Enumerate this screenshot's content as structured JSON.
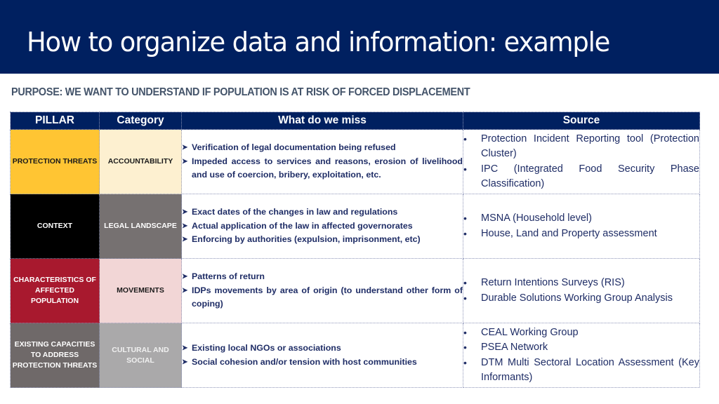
{
  "title": "How to organize data and information: example",
  "purpose": "PURPOSE: WE WANT TO UNDERSTAND IF POPULATION IS AT RISK OF FORCED DISPLACEMENT",
  "table": {
    "headers": [
      "PILLAR",
      "Category",
      "What do we miss",
      "Source"
    ],
    "rows": [
      {
        "pillar": "PROTECTION THREATS",
        "pillar_color": "#ffc533",
        "pillar_text_color": "#1a1a1a",
        "category": "ACCOUNTABILITY",
        "category_color": "#fdf0d0",
        "category_text_color": "#1a1a1a",
        "miss": [
          "Verification of legal documentation being refused",
          "Impeded access to services and reasons, erosion of livelihood and use of coercion, bribery, exploitation, etc."
        ],
        "source": [
          "Protection Incident Reporting tool (Protection Cluster)",
          "IPC (Integrated Food Security Phase Classification)"
        ]
      },
      {
        "pillar": "CONTEXT",
        "pillar_color": "#000000",
        "pillar_text_color": "#ffffff",
        "category": "LEGAL LANDSCAPE",
        "category_color": "#767171",
        "category_text_color": "#ffffff",
        "miss": [
          "Exact dates of the changes in law and regulations",
          "Actual application of the law in affected governorates",
          "Enforcing by authorities (expulsion, imprisonment, etc)"
        ],
        "source": [
          "MSNA (Household level)",
          "House, Land and Property assessment"
        ]
      },
      {
        "pillar": "CHARACTERISTICS OF AFFECTED POPULATION",
        "pillar_color": "#a8192e",
        "pillar_text_color": "#ffffff",
        "category": "MOVEMENTS",
        "category_color": "#f2d6d6",
        "category_text_color": "#1a1a1a",
        "miss": [
          "Patterns of return",
          "IDPs movements by area of origin (to understand other form of coping)"
        ],
        "source": [
          "Return Intentions Surveys (RIS)",
          "Durable Solutions Working Group Analysis"
        ]
      },
      {
        "pillar": "EXISTING CAPACITIES TO ADDRESS PROTECTION THREATS",
        "pillar_color": "#6f6969",
        "pillar_text_color": "#ffffff",
        "category": "CULTURAL AND SOCIAL",
        "category_color": "#aaa9aa",
        "category_text_color": "#f0f0f0",
        "miss": [
          "Existing local NGOs or associations",
          "Social cohesion and/or tension with host communities"
        ],
        "source": [
          "CEAL Working Group",
          "PSEA Network",
          "DTM Multi Sectoral Location Assessment (Key Informants)"
        ]
      }
    ]
  },
  "icons": {
    "miss_bullet": "arrowhead-bullet-icon",
    "source_bullet": "dot-bullet-icon"
  },
  "colors": {
    "header_bg": "#002060",
    "body_text": "#1f2d66",
    "purpose_text": "#44546a"
  }
}
